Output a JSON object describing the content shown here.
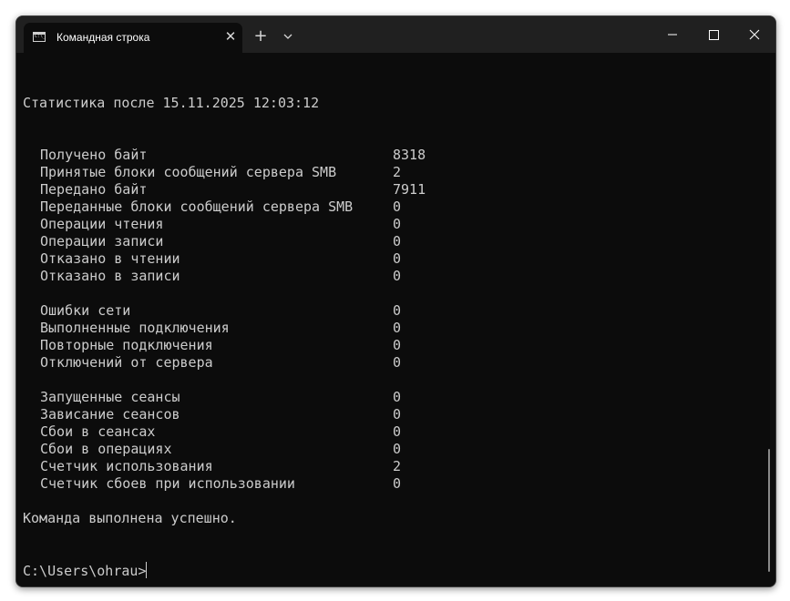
{
  "window": {
    "tab_title": "Командная строка",
    "tab_icon": "cmd-icon",
    "new_tab_label": "+",
    "close_tab_label": "✕"
  },
  "terminal": {
    "header": "Статистика после 15.11.2025 12:03:12",
    "stats": [
      {
        "label": "Получено байт",
        "value": "8318"
      },
      {
        "label": "Принятые блоки сообщений сервера SMB",
        "value": "2"
      },
      {
        "label": "Передано байт",
        "value": "7911"
      },
      {
        "label": "Переданные блоки сообщений сервера SMB",
        "value": "0"
      },
      {
        "label": "Операции чтения",
        "value": "0"
      },
      {
        "label": "Операции записи",
        "value": "0"
      },
      {
        "label": "Отказано в чтении",
        "value": "0"
      },
      {
        "label": "Отказано в записи",
        "value": "0"
      },
      {
        "label": "Ошибки сети",
        "value": "0"
      },
      {
        "label": "Выполненные подключения",
        "value": "0"
      },
      {
        "label": "Повторные подключения",
        "value": "0"
      },
      {
        "label": "Отключений от сервера",
        "value": "0"
      },
      {
        "label": "Запущенные сеансы",
        "value": "0"
      },
      {
        "label": "Зависание сеансов",
        "value": "0"
      },
      {
        "label": "Сбои в сеансах",
        "value": "0"
      },
      {
        "label": "Сбои в операциях",
        "value": "0"
      },
      {
        "label": "Счетчик использования",
        "value": "2"
      },
      {
        "label": "Счетчик сбоев при использовании",
        "value": "0"
      }
    ],
    "result_message": "Команда выполнена успешно.",
    "prompt": "C:\\Users\\ohrau>"
  },
  "colors": {
    "background": "#0c0c0c",
    "titlebar": "#202020",
    "text": "#cccccc"
  }
}
